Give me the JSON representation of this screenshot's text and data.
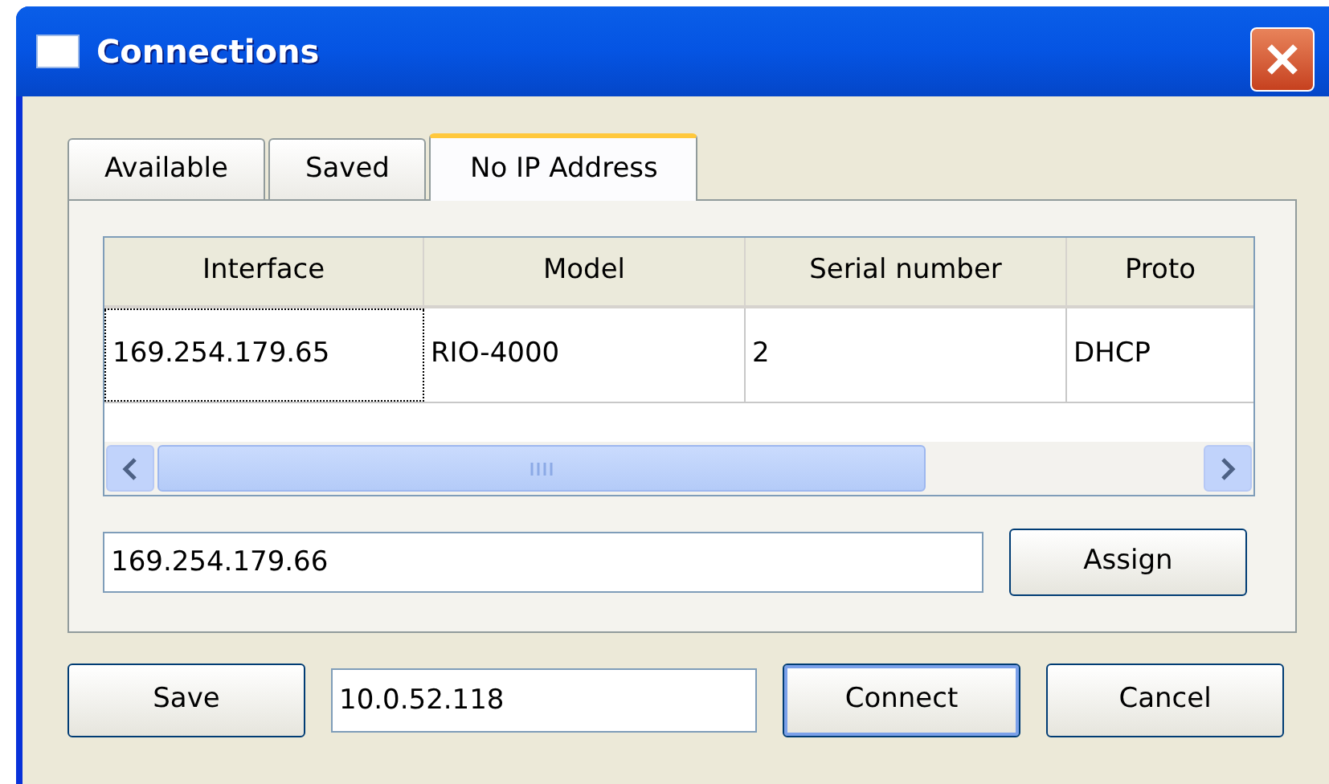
{
  "window": {
    "title": "Connections"
  },
  "tabs": [
    {
      "label": "Available",
      "selected": false
    },
    {
      "label": "Saved",
      "selected": false
    },
    {
      "label": "No IP Address",
      "selected": true
    }
  ],
  "table": {
    "columns": [
      "Interface",
      "Model",
      "Serial number",
      "Proto"
    ],
    "rows": [
      {
        "cells": [
          {
            "text": "169.254.179.65",
            "focused": true
          },
          {
            "text": "RIO-4000",
            "focused": false
          },
          {
            "text": "2",
            "focused": false
          },
          {
            "text": "DHCP",
            "focused": false
          }
        ]
      }
    ]
  },
  "assign": {
    "value": "169.254.179.66",
    "button": "Assign"
  },
  "footer": {
    "save": "Save",
    "address": "10.0.52.118",
    "connect": "Connect",
    "cancel": "Cancel"
  }
}
